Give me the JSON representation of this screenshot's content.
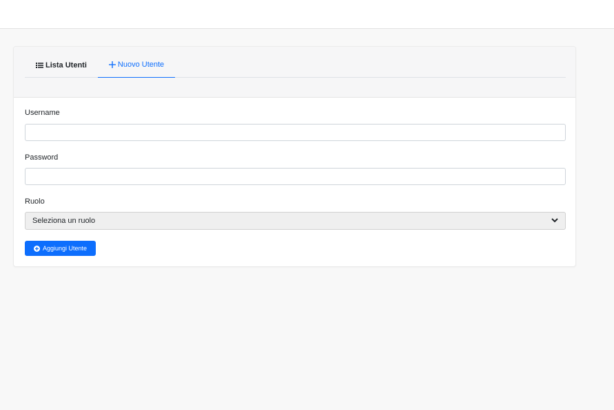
{
  "tabs": {
    "list_label": "Lista Utenti",
    "new_label": "Nuovo Utente"
  },
  "form": {
    "username_label": "Username",
    "username_value": "",
    "password_label": "Password",
    "password_value": "",
    "role_label": "Ruolo",
    "role_selected": "Seleziona un ruolo",
    "submit_label": "Aggiungi Utente"
  },
  "colors": {
    "accent": "#0d6efd",
    "page_bg": "#f8f8f8"
  },
  "icons": {
    "list_tab": "list-icon",
    "new_tab": "plus-icon",
    "role_select": "chevron-down-icon",
    "submit": "plus-circle-icon"
  }
}
